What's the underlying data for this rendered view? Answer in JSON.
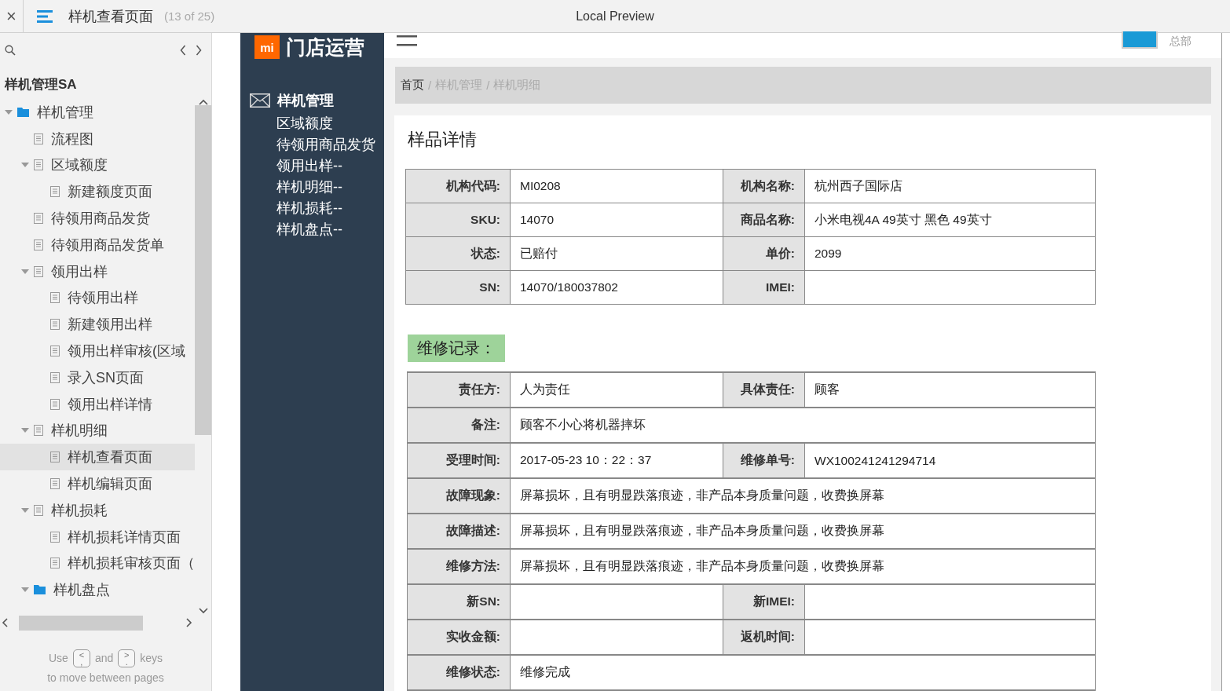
{
  "topbar": {
    "close": "×",
    "page_title": "样机查看页面",
    "page_count": "(13 of 25)",
    "window_title": "Local Preview"
  },
  "navigator": {
    "project_title": "样机管理SA",
    "tree": [
      {
        "label": "样机管理",
        "kind": "folder",
        "expanded": true,
        "selected": false,
        "children": [
          {
            "label": "流程图",
            "kind": "page",
            "selected": false
          },
          {
            "label": "区域额度",
            "kind": "page",
            "expanded": true,
            "selected": false,
            "children": [
              {
                "label": "新建额度页面",
                "kind": "page",
                "selected": false
              }
            ]
          },
          {
            "label": "待领用商品发货",
            "kind": "page",
            "selected": false
          },
          {
            "label": "待领用商品发货单",
            "kind": "page",
            "selected": false
          },
          {
            "label": "领用出样",
            "kind": "page",
            "expanded": true,
            "selected": false,
            "children": [
              {
                "label": "待领用出样",
                "kind": "page",
                "selected": false
              },
              {
                "label": "新建领用出样",
                "kind": "page",
                "selected": false
              },
              {
                "label": "领用出样审核(区域",
                "kind": "page",
                "selected": false
              },
              {
                "label": "录入SN页面",
                "kind": "page",
                "selected": false
              },
              {
                "label": "领用出样详情",
                "kind": "page",
                "selected": false
              }
            ]
          },
          {
            "label": "样机明细",
            "kind": "page",
            "expanded": true,
            "selected": false,
            "children": [
              {
                "label": "样机查看页面",
                "kind": "page",
                "selected": true
              },
              {
                "label": "样机编辑页面",
                "kind": "page",
                "selected": false
              }
            ]
          },
          {
            "label": "样机损耗",
            "kind": "page",
            "expanded": true,
            "selected": false,
            "children": [
              {
                "label": "样机损耗详情页面",
                "kind": "page",
                "selected": false
              },
              {
                "label": "样机损耗审核页面（",
                "kind": "page",
                "selected": false
              }
            ]
          },
          {
            "label": "样机盘点",
            "kind": "folder",
            "expanded": true,
            "selected": false
          }
        ]
      }
    ],
    "hint": {
      "use": "Use",
      "key_prev": {
        "top": "<",
        "bottom": ","
      },
      "and": "and",
      "key_next": {
        "top": ">",
        "bottom": "."
      },
      "keys": "keys",
      "line2": "to move between pages"
    }
  },
  "prototype": {
    "logo_mark": "mi",
    "logo_text": "门店运营",
    "user_label": "总部",
    "menu": {
      "title": "样机管理",
      "items": [
        "区域额度",
        "待领用商品发货",
        "领用出样--",
        "样机明细--",
        "样机损耗--",
        "样机盘点--"
      ]
    },
    "breadcrumb": {
      "separator": "/",
      "items": [
        "首页",
        "样机管理",
        "样机明细"
      ]
    },
    "detail": {
      "title": "样品详情",
      "rows": [
        [
          {
            "label": "机构代码:",
            "value": "MI0208"
          },
          {
            "label": "机构名称:",
            "value": "杭州西子国际店"
          }
        ],
        [
          {
            "label": "SKU:",
            "value": "14070"
          },
          {
            "label": "商品名称:",
            "value": "小米电视4A 49英寸 黑色 49英寸"
          }
        ],
        [
          {
            "label": "状态:",
            "value": "已赔付"
          },
          {
            "label": "单价:",
            "value": "2099"
          }
        ],
        [
          {
            "label": "SN:",
            "value": "14070/180037802"
          },
          {
            "label": "IMEI:"
          }
        ]
      ]
    },
    "repair": {
      "heading": "维修记录：",
      "rows": [
        [
          {
            "label": "责任方:",
            "value": "人为责任"
          },
          {
            "label": "具体责任:",
            "value": "顾客"
          }
        ],
        [
          {
            "label": "备注:",
            "value": "顾客不小心将机器摔坏"
          }
        ],
        [
          {
            "label": "受理时间:",
            "value": "2017-05-23  10：22：37"
          },
          {
            "label": "维修单号:",
            "value": "WX100241241294714"
          }
        ],
        [
          {
            "label": "故障现象:",
            "value": "屏幕损坏，且有明显跌落痕迹，非产品本身质量问题，收费换屏幕"
          }
        ],
        [
          {
            "label": "故障描述:",
            "value": "屏幕损坏，且有明显跌落痕迹，非产品本身质量问题，收费换屏幕"
          }
        ],
        [
          {
            "label": "维修方法:",
            "value": "屏幕损坏，且有明显跌落痕迹，非产品本身质量问题，收费换屏幕"
          }
        ],
        [
          {
            "label": "新SN:"
          },
          {
            "label": "新IMEI:"
          }
        ],
        [
          {
            "label": "实收金额:"
          },
          {
            "label": "返机时间:"
          }
        ],
        [
          {
            "label": "维修状态:",
            "value": "维修完成"
          }
        ]
      ]
    }
  }
}
